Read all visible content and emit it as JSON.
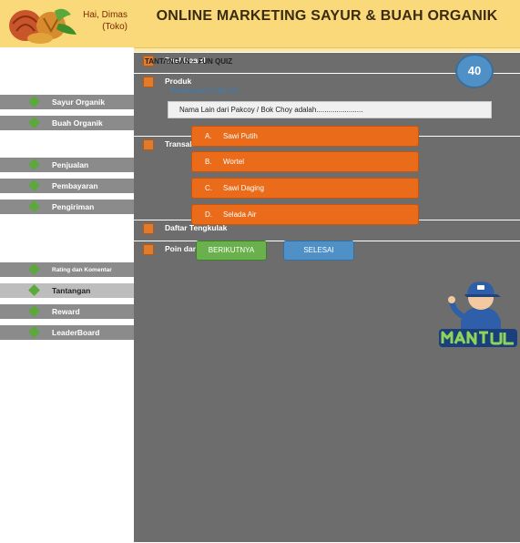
{
  "header": {
    "user_greeting": "Hai, Dimas",
    "user_role": "(Toko)",
    "title": "ONLINE MARKETING SAYUR & BUAH ORGANIK"
  },
  "sidebar": {
    "items": [
      {
        "label": "Dashboard",
        "level": "main"
      },
      {
        "label": "Produk",
        "level": "main"
      },
      {
        "label": "Sayur Organik",
        "level": "sub"
      },
      {
        "label": "Buah Organik",
        "level": "sub"
      },
      {
        "label": "Transaksi",
        "level": "main"
      },
      {
        "label": "Penjualan",
        "level": "sub"
      },
      {
        "label": "Pembayaran",
        "level": "sub"
      },
      {
        "label": "Pengiriman",
        "level": "sub"
      },
      {
        "label": "Daftar Tengkulak",
        "level": "main"
      },
      {
        "label": "Poin dan Level",
        "level": "main"
      },
      {
        "label": "Rating dan Komentar",
        "level": "sub"
      },
      {
        "label": "Tantangan",
        "level": "sub",
        "active": true
      },
      {
        "label": "Reward",
        "level": "sub"
      },
      {
        "label": "LeaderBoard",
        "level": "sub"
      }
    ]
  },
  "quiz": {
    "section_title": "TANTANGAN – FUN QUIZ",
    "timer": "40",
    "progress": "Pertanyaan 5 dari 10",
    "question": "Nama Lain dari Pakcoy / Bok Choy adalah.......................",
    "options": [
      {
        "letter": "A.",
        "text": "Sawi Putih"
      },
      {
        "letter": "B.",
        "text": "Wortel"
      },
      {
        "letter": "C.",
        "text": "Sawi Daging"
      },
      {
        "letter": "D.",
        "text": "Selada Air"
      }
    ],
    "next_label": "BERIKUTNYA",
    "finish_label": "SELESAI"
  },
  "mascot": {
    "name": "MANTUL"
  },
  "colors": {
    "header_bg": "#fad97a",
    "content_bg": "#fce7a8",
    "option_orange": "#ea6b1a",
    "next_green": "#6ab04c",
    "finish_blue": "#4f90c7"
  }
}
